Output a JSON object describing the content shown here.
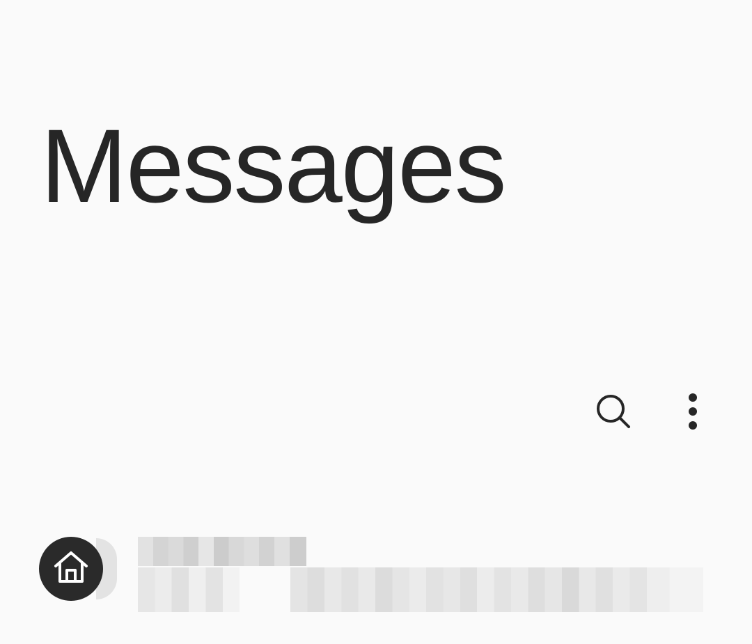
{
  "header": {
    "title": "Messages"
  },
  "actions": {
    "search_icon": "search-icon",
    "more_icon": "more-options-icon"
  },
  "conversations": [
    {
      "avatar_icon": "home-icon",
      "name": "",
      "preview": ""
    }
  ],
  "colors": {
    "background": "#fafafa",
    "text": "#262626",
    "avatar_bg": "#2a2a2a",
    "avatar_icon": "#ffffff"
  }
}
